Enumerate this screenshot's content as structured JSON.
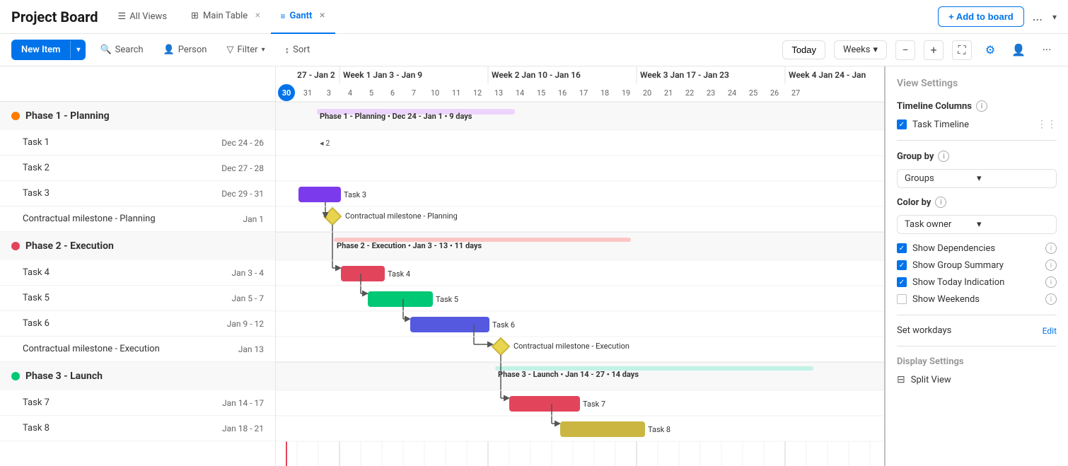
{
  "header": {
    "title": "Project Board",
    "all_views_label": "All Views",
    "tabs": [
      {
        "id": "main-table",
        "label": "Main Table",
        "icon": "⊞",
        "active": false,
        "closable": true
      },
      {
        "id": "gantt",
        "label": "Gantt",
        "icon": "≡",
        "active": true,
        "closable": true
      }
    ],
    "add_board_label": "+ Add to board",
    "dots_label": "...",
    "chevron_label": "‹"
  },
  "toolbar": {
    "new_item_label": "New Item",
    "search_label": "Search",
    "person_label": "Person",
    "filter_label": "Filter",
    "sort_label": "Sort",
    "today_label": "Today",
    "weeks_label": "Weeks",
    "zoom_minus": "−",
    "zoom_plus": "+"
  },
  "gantt": {
    "weeks": [
      {
        "label": "27 - Jan 2",
        "days": [
          "30",
          "31",
          "3",
          "4",
          "5",
          "6",
          "7"
        ],
        "colspan": 7
      },
      {
        "label": "Week 1  Jan 3 - Jan 9",
        "days": [
          "3",
          "4",
          "5",
          "6",
          "7"
        ],
        "colspan": 5
      },
      {
        "label": "Week 2  Jan 10 - Jan 16",
        "days": [
          "10",
          "11",
          "12",
          "13",
          "14",
          "15",
          "16"
        ],
        "colspan": 7
      },
      {
        "label": "Week 3  Jan 17 - Jan 23",
        "days": [
          "17",
          "18",
          "19",
          "20",
          "21",
          "22",
          "23"
        ],
        "colspan": 7
      },
      {
        "label": "Week 4  Jan 24 - Jan",
        "days": [
          "24",
          "25",
          "26",
          "27"
        ],
        "colspan": 4
      }
    ]
  },
  "left": {
    "groups": [
      {
        "id": "phase1",
        "name": "Phase 1 - Planning",
        "color": "orange",
        "tasks": [
          {
            "name": "Task 1",
            "date": "Dec 24 - 26"
          },
          {
            "name": "Task 2",
            "date": "Dec 27 - 28"
          },
          {
            "name": "Task 3",
            "date": "Dec 29 - 31"
          },
          {
            "name": "Contractual milestone - Planning",
            "date": "Jan 1"
          }
        ]
      },
      {
        "id": "phase2",
        "name": "Phase 2 - Execution",
        "color": "red",
        "tasks": [
          {
            "name": "Task 4",
            "date": "Jan 3 - 4"
          },
          {
            "name": "Task 5",
            "date": "Jan 5 - 7"
          },
          {
            "name": "Task 6",
            "date": "Jan 9 - 12"
          },
          {
            "name": "Contractual milestone - Execution",
            "date": "Jan 13"
          }
        ]
      },
      {
        "id": "phase3",
        "name": "Phase 3 - Launch",
        "color": "green",
        "tasks": [
          {
            "name": "Task 7",
            "date": "Jan 14 - 17"
          },
          {
            "name": "Task 8",
            "date": "Jan 18 - 21"
          }
        ]
      }
    ]
  },
  "right_panel": {
    "view_settings_label": "View Settings",
    "timeline_columns_label": "Timeline Columns",
    "task_timeline_label": "Task Timeline",
    "group_by_label": "Group by",
    "group_by_value": "Groups",
    "color_by_label": "Color by",
    "color_by_value": "Task owner",
    "show_dependencies_label": "Show Dependencies",
    "show_group_summary_label": "Show Group Summary",
    "show_today_label": "Show Today Indication",
    "show_weekends_label": "Show Weekends",
    "set_workdays_label": "Set workdays",
    "edit_label": "Edit",
    "display_settings_label": "Display Settings",
    "split_view_label": "Split View"
  }
}
